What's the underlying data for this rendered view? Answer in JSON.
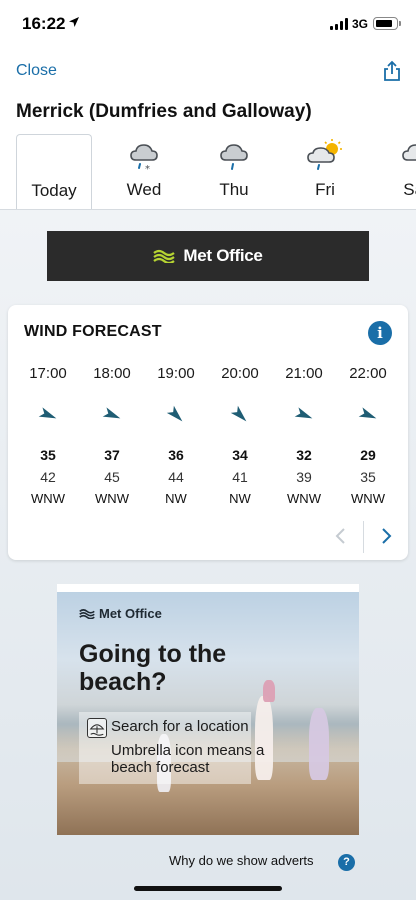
{
  "status_bar": {
    "time": "16:22",
    "network": "3G"
  },
  "nav": {
    "close_label": "Close",
    "share_icon": "share-icon"
  },
  "location": {
    "title": "Merrick (Dumfries and Galloway)"
  },
  "days": [
    {
      "label": "Today",
      "icon": "none",
      "active": true
    },
    {
      "label": "Wed",
      "icon": "sleet-cloud-icon"
    },
    {
      "label": "Thu",
      "icon": "rain-cloud-icon"
    },
    {
      "label": "Fri",
      "icon": "sun-cloud-rain-icon"
    },
    {
      "label": "Sat",
      "icon": "cloud-icon"
    }
  ],
  "banner": {
    "label": "Met Office"
  },
  "wind": {
    "title": "WIND FORECAST",
    "hours": [
      {
        "time": "17:00",
        "speed": "35",
        "gust": "42",
        "dir": "WNW"
      },
      {
        "time": "18:00",
        "speed": "37",
        "gust": "45",
        "dir": "WNW"
      },
      {
        "time": "19:00",
        "speed": "36",
        "gust": "44",
        "dir": "NW"
      },
      {
        "time": "20:00",
        "speed": "34",
        "gust": "41",
        "dir": "NW"
      },
      {
        "time": "21:00",
        "speed": "32",
        "gust": "39",
        "dir": "WNW"
      },
      {
        "time": "22:00",
        "speed": "29",
        "gust": "35",
        "dir": "WNW"
      }
    ]
  },
  "ad": {
    "logo": "Met Office",
    "headline": "Going to the beach?",
    "line1": "Search for a location",
    "line2": "Umbrella icon means a beach forecast"
  },
  "footer": {
    "why_ads": "Why do we show adverts"
  },
  "colors": {
    "accent": "#1a6ea8",
    "arrow": "#1f5d74",
    "banner": "#2b2b2b",
    "logo_green": "#b6d432"
  }
}
